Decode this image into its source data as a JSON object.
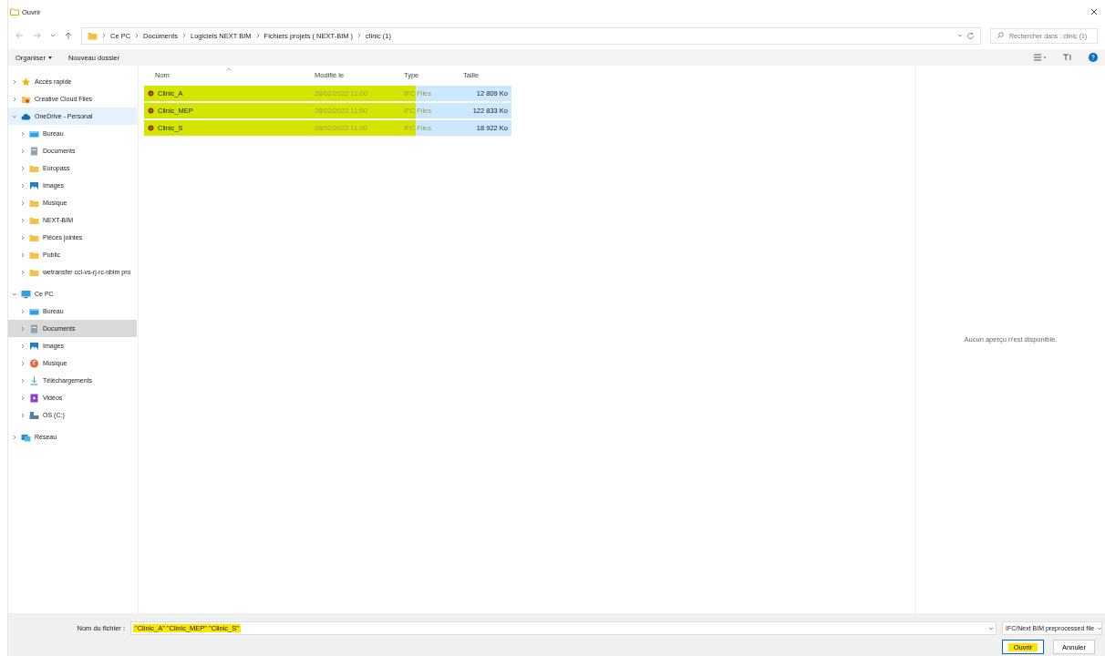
{
  "window": {
    "title": "Ouvrir"
  },
  "address": {
    "path": [
      "Ce PC",
      "Documents",
      "Logiciels NEXT BIM",
      "Fichiers projets ( NEXT-BIM )",
      "clinic (1)"
    ]
  },
  "search": {
    "placeholder": "Rechercher dans : clinic (1)"
  },
  "toolbar": {
    "buttons": [
      {
        "label": "Organiser",
        "kind": "menu"
      },
      {
        "label": "Nouveau dossier",
        "kind": "plain"
      }
    ]
  },
  "sidebar": {
    "items": [
      {
        "label": "Accès rapide",
        "kind": "star",
        "expanded": false,
        "selected": false,
        "hovered": false
      },
      {
        "label": "Creative Cloud Files",
        "kind": "cloudfiles",
        "expanded": false,
        "selected": false,
        "hovered": false
      },
      {
        "label": "OneDrive - Personal",
        "kind": "cloud",
        "expanded": true,
        "selected": false,
        "hovered": true,
        "children": [
          {
            "label": "Bureau",
            "kind": "desktop",
            "expanded": false,
            "selected": false,
            "hovered": false
          },
          {
            "label": "Documents",
            "kind": "documents",
            "expanded": false,
            "selected": false,
            "hovered": false
          },
          {
            "label": "Europass",
            "kind": "folder",
            "expanded": false,
            "selected": false,
            "hovered": false
          },
          {
            "label": "Images",
            "kind": "images",
            "expanded": false,
            "selected": false,
            "hovered": false
          },
          {
            "label": "Musique",
            "kind": "folder",
            "expanded": false,
            "selected": false,
            "hovered": false
          },
          {
            "label": "NEXT-BIM",
            "kind": "folder",
            "expanded": false,
            "selected": false,
            "hovered": false
          },
          {
            "label": "Pièces jointes",
            "kind": "folder",
            "expanded": false,
            "selected": false,
            "hovered": false
          },
          {
            "label": "Public",
            "kind": "folder",
            "expanded": false,
            "selected": false,
            "hovered": false
          },
          {
            "label": "wetransfer cci-vs-rj-rc-nbim pro",
            "kind": "folder",
            "expanded": false,
            "selected": false,
            "hovered": false
          }
        ]
      },
      {
        "label": "Ce PC",
        "kind": "pc",
        "expanded": true,
        "selected": false,
        "hovered": false,
        "children": [
          {
            "label": "Bureau",
            "kind": "desktop",
            "expanded": false,
            "selected": false,
            "hovered": false
          },
          {
            "label": "Documents",
            "kind": "documents",
            "expanded": false,
            "selected": true,
            "hovered": false
          },
          {
            "label": "Images",
            "kind": "images",
            "expanded": false,
            "selected": false,
            "hovered": false
          },
          {
            "label": "Musique",
            "kind": "music",
            "expanded": false,
            "selected": false,
            "hovered": false
          },
          {
            "label": "Téléchargements",
            "kind": "download",
            "expanded": false,
            "selected": false,
            "hovered": false
          },
          {
            "label": "Vidéos",
            "kind": "videos",
            "expanded": false,
            "selected": false,
            "hovered": false
          },
          {
            "label": "OS (C:)",
            "kind": "drive",
            "expanded": false,
            "selected": false,
            "hovered": false
          }
        ]
      },
      {
        "label": "Réseau",
        "kind": "network",
        "expanded": false,
        "selected": false,
        "hovered": false
      }
    ]
  },
  "table": {
    "columns": [
      "Nom",
      "Modifié le",
      "Type",
      "Taille"
    ],
    "rows": [
      {
        "name": "Clinic_A",
        "modified": "28/02/2022 11:00",
        "type": "IFC Files",
        "size": "12 809 Ko",
        "selected": true,
        "highlighted": true
      },
      {
        "name": "Clinic_MEP",
        "modified": "28/02/2022 11:00",
        "type": "IFC Files",
        "size": "122 833 Ko",
        "selected": true,
        "highlighted": true
      },
      {
        "name": "Clinic_S",
        "modified": "28/02/2022 11:00",
        "type": "IFC Files",
        "size": "18 922 Ko",
        "selected": true,
        "highlighted": true
      }
    ]
  },
  "preview": {
    "message": "Aucun aperçu n'est disponible."
  },
  "filename": {
    "label": "Nom du fichier :",
    "value": "\"Clinic_A\" \"Clinic_MEP\" \"Clinic_S\"",
    "highlighted": true
  },
  "filter": {
    "value": "IFC/Next BIM preprocessed file"
  },
  "buttons": [
    {
      "label": "Ouvrir",
      "kind": "primary",
      "highlighted": true
    },
    {
      "label": "Annuler",
      "kind": "secondary",
      "highlighted": false
    }
  ]
}
